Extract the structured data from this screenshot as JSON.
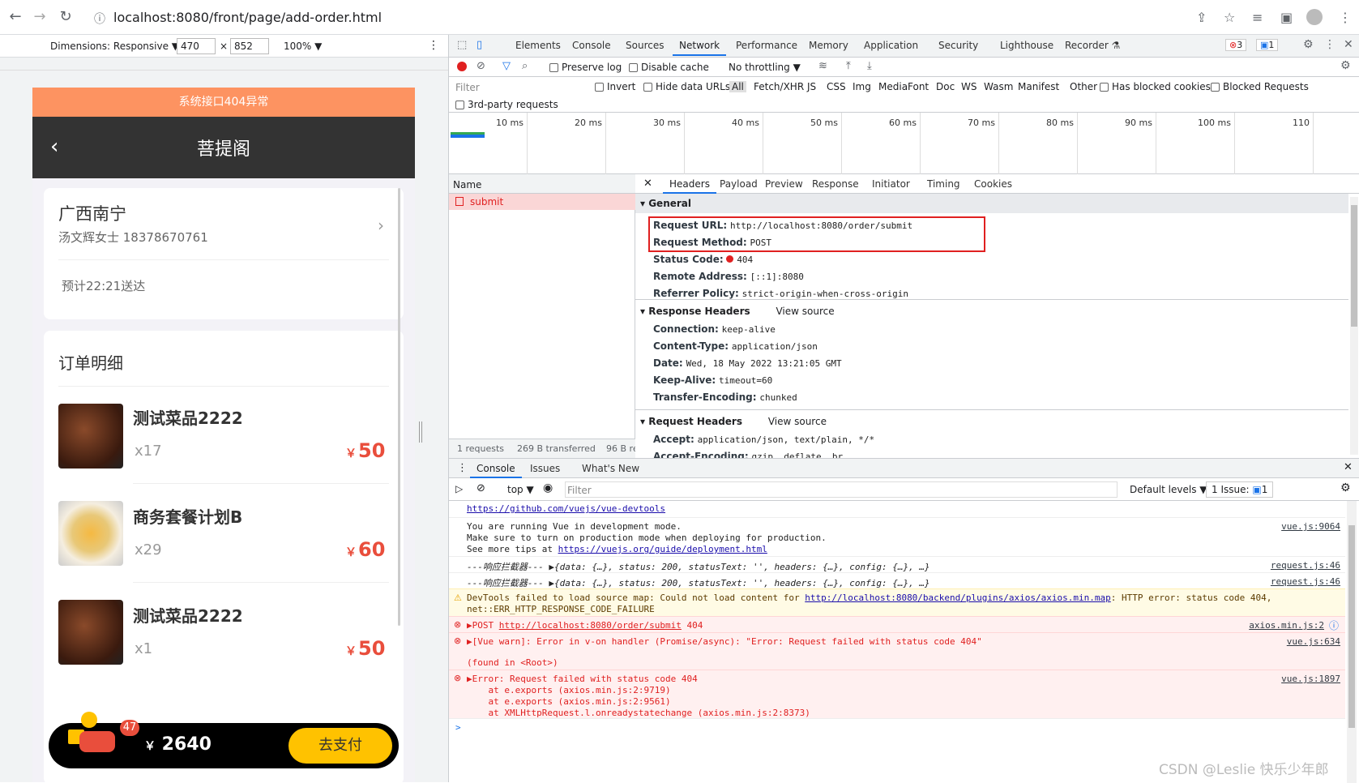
{
  "browser": {
    "url": "localhost:8080/front/page/add-order.html"
  },
  "device_toolbar": {
    "dimensions_label": "Dimensions: Responsive ▼",
    "width": "470",
    "times": "×",
    "height": "852",
    "zoom": "100% ▼"
  },
  "mobile": {
    "error_banner": "系统接口404异常",
    "title": "菩提阁",
    "address": {
      "city": "广西南宁",
      "contact": "汤文辉女士  18378670761",
      "eta": "预计22:21送达"
    },
    "order_title": "订单明细",
    "dishes": [
      {
        "name": "测试菜品2222",
        "qty": "x17",
        "currency": "￥",
        "price": "50"
      },
      {
        "name": "商务套餐计划B",
        "qty": "x29",
        "currency": "￥",
        "price": "60"
      },
      {
        "name": "测试菜品2222",
        "qty": "x1",
        "currency": "￥",
        "price": "50"
      }
    ],
    "cart_badge": "47",
    "total_currency": "￥",
    "total": "2640",
    "pay_label": "去支付"
  },
  "devtools": {
    "tabs": [
      "Elements",
      "Console",
      "Sources",
      "Network",
      "Performance",
      "Memory",
      "Application",
      "Security",
      "Lighthouse",
      "Recorder ⚗"
    ],
    "active_tab": "Network",
    "error_count": "3",
    "message_count": "1",
    "network_toolbar": {
      "preserve_log": "Preserve log",
      "disable_cache": "Disable cache",
      "throttling": "No throttling"
    },
    "filter_bar": {
      "filter_placeholder": "Filter",
      "invert": "Invert",
      "hide_data_urls": "Hide data URLs",
      "types": [
        "All",
        "Fetch/XHR",
        "JS",
        "CSS",
        "Img",
        "Media",
        "Font",
        "Doc",
        "WS",
        "Wasm",
        "Manifest",
        "Other"
      ],
      "has_blocked_cookies": "Has blocked cookies",
      "blocked_requests": "Blocked Requests",
      "third_party": "3rd-party requests"
    },
    "timeline_ticks": [
      "10 ms",
      "20 ms",
      "30 ms",
      "40 ms",
      "50 ms",
      "60 ms",
      "70 ms",
      "80 ms",
      "90 ms",
      "100 ms",
      "110"
    ],
    "request_list": {
      "header": "Name",
      "items": [
        "submit"
      ],
      "status_bar": [
        "1 requests",
        "269 B transferred",
        "96 B re"
      ]
    },
    "detail_tabs": [
      "Headers",
      "Payload",
      "Preview",
      "Response",
      "Initiator",
      "Timing",
      "Cookies"
    ],
    "general": {
      "title": "General",
      "rows": [
        {
          "key": "Request URL:",
          "value": "http://localhost:8080/order/submit"
        },
        {
          "key": "Request Method:",
          "value": "POST"
        },
        {
          "key": "Status Code:",
          "value": "404"
        },
        {
          "key": "Remote Address:",
          "value": "[::1]:8080"
        },
        {
          "key": "Referrer Policy:",
          "value": "strict-origin-when-cross-origin"
        }
      ]
    },
    "response_headers": {
      "title": "Response Headers",
      "view_source": "View source",
      "rows": [
        {
          "key": "Connection:",
          "value": "keep-alive"
        },
        {
          "key": "Content-Type:",
          "value": "application/json"
        },
        {
          "key": "Date:",
          "value": "Wed, 18 May 2022 13:21:05 GMT"
        },
        {
          "key": "Keep-Alive:",
          "value": "timeout=60"
        },
        {
          "key": "Transfer-Encoding:",
          "value": "chunked"
        }
      ]
    },
    "request_headers": {
      "title": "Request Headers",
      "view_source": "View source",
      "rows": [
        {
          "key": "Accept:",
          "value": "application/json, text/plain, */*"
        },
        {
          "key": "Accept-Encoding:",
          "value": "gzip, deflate, br"
        }
      ]
    },
    "drawer": {
      "tabs": [
        "Console",
        "Issues",
        "What's New"
      ],
      "context": "top ▼",
      "filter_placeholder": "Filter",
      "levels": "Default levels ▼",
      "issues": "1 Issue:",
      "issues_count": "1",
      "messages": {
        "m0_link": "https://github.com/vuejs/vue-devtools",
        "m1_l1": "You are running Vue in development mode.",
        "m1_l2": "Make sure to turn on production mode when deploying for production.",
        "m1_l3_prefix": "See more tips at ",
        "m1_l3_link": "https://vuejs.org/guide/deployment.html",
        "m1_src": "vue.js:9064",
        "m2_text": "---响应拦截器--- ▶{data: {…}, status: 200, statusText: '', headers: {…}, config: {…}, …}",
        "m2_src": "request.js:46",
        "m3_text": "---响应拦截器--- ▶{data: {…}, status: 200, statusText: '', headers: {…}, config: {…}, …}",
        "m3_src": "request.js:46",
        "m4_prefix": "DevTools failed to load source map: Could not load content for ",
        "m4_link": "http://localhost:8080/backend/plugins/axios/axios.min.map",
        "m4_suffix": ": HTTP error: status code 404,",
        "m4_l2": "net::ERR_HTTP_RESPONSE_CODE_FAILURE",
        "m5_prefix": "▶POST ",
        "m5_link": "http://localhost:8080/order/submit",
        "m5_suffix": " 404",
        "m5_src": "axios.min.js:2",
        "m6_l1": "▶[Vue warn]: Error in v-on handler (Promise/async): \"Error: Request failed with status code 404\"",
        "m6_l2": "(found in <Root>)",
        "m6_src": "vue.js:634",
        "m7_l1": "▶Error: Request failed with status code 404",
        "m7_l2": "    at e.exports (axios.min.js:2:9719)",
        "m7_l3": "    at e.exports (axios.min.js:2:9561)",
        "m7_l4": "    at XMLHttpRequest.l.onreadystatechange (axios.min.js:2:8373)",
        "m7_src": "vue.js:1897",
        "prompt": ">"
      }
    }
  },
  "watermark": "CSDN @Leslie 快乐少年郎"
}
